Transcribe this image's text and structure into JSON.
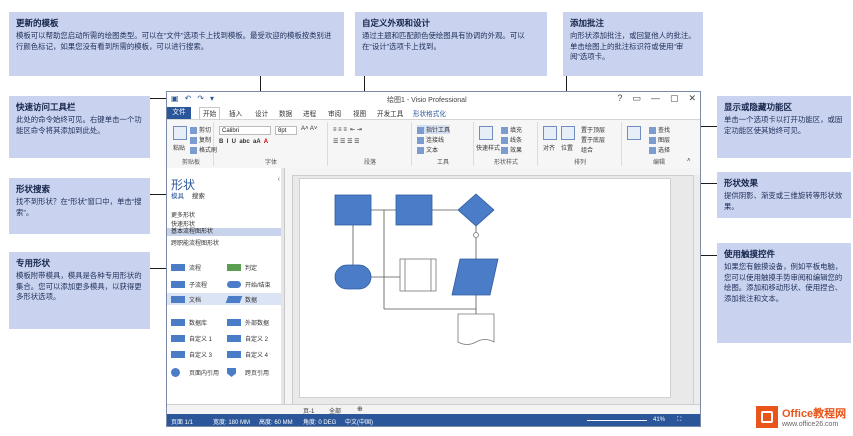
{
  "callouts": {
    "templates": {
      "title": "更新的模板",
      "body": "模板可以帮助您启动所需的绘图类型。可以在“文件”选项卡上找到模板。最受欢迎的模板按类别进行颜色标记，如果您没有看到所需的模板，可以进行搜索。"
    },
    "appearance": {
      "title": "自定义外观和设计",
      "body": "通过主题和匹配颜色使绘图具有协调的外观。可以在“设计”选项卡上找到。"
    },
    "comments": {
      "title": "添加批注",
      "body": "向形状添加批注，或回复他人的批注。单击绘图上的批注标识符或使用“审阅”选项卡。"
    },
    "qat": {
      "title": "快速访问工具栏",
      "body": "此处的命令始终可见。右键单击一个功能区命令将其添加到此处。"
    },
    "ribbon": {
      "title": "显示或隐藏功能区",
      "body": "单击一个选项卡以打开功能区，或固定功能区使其始终可见。"
    },
    "search": {
      "title": "形状搜索",
      "body": "找不到形状？在“形状”窗口中，单击“搜索”。"
    },
    "effects": {
      "title": "形状效果",
      "body": "提供阴影、渐变或三维旋转等形状效果。"
    },
    "stencils": {
      "title": "专用形状",
      "body": "模板附带模具，模具是各种专用形状的集合。您可以添加更多模具，以获得更多形状选项。"
    },
    "touch": {
      "title": "使用触摸控件",
      "body": "如果您有触摸设备，例如平板电脑，您可以使用触摸手势审阅和编辑您的绘图。添加和移动形状、使用捏合、添加批注和文本。"
    }
  },
  "window": {
    "title": "绘图1 - Visio Professional",
    "controls": [
      "?",
      "▭",
      "—",
      "▢",
      "✕"
    ],
    "qat_icons": [
      "save-icon",
      "undo-icon",
      "redo-icon",
      "customize-icon"
    ]
  },
  "tabs": [
    "文件",
    "开始",
    "插入",
    "设计",
    "数据",
    "进程",
    "审阅",
    "视图",
    "开发工具",
    "形状格式化"
  ],
  "ribbon": {
    "groups": [
      "剪贴板",
      "字体",
      "段落",
      "工具",
      "形状样式",
      "排列",
      "编辑"
    ],
    "font_name": "Calibri",
    "font_size": "8pt",
    "clipboard_items": [
      "粘贴",
      "剪切",
      "复制",
      "格式刷"
    ],
    "tools_items": [
      "指针工具",
      "连接线",
      "文本"
    ],
    "style_items": [
      "快速样式",
      "填充",
      "线条",
      "效果"
    ],
    "arrange_items": [
      "对齐",
      "位置",
      "置于顶层",
      "置于底层",
      "组合"
    ],
    "edit_items": [
      "查找",
      "图层",
      "选择"
    ]
  },
  "shapes_pane": {
    "title": "形状",
    "search_label": "模具",
    "search_text": "搜索",
    "links": [
      "更多形状",
      "快速形状"
    ],
    "selected": "基本流程图形状",
    "second": "跨职能流程图形状",
    "stencils": [
      [
        "流程",
        "判定"
      ],
      [
        "子流程",
        "开始/结束"
      ],
      [
        "文档",
        "数据"
      ],
      [
        "数据库",
        "外部数据"
      ],
      [
        "自定义 1",
        "自定义 2"
      ],
      [
        "自定义 3",
        "自定义 4"
      ],
      [
        "页面内引用",
        "跨页引用"
      ]
    ]
  },
  "page_tabs": {
    "page": "页-1",
    "all": "全部"
  },
  "status": {
    "page": "页面 1/1",
    "width": "宽度: 180 MM",
    "height": "高度: 60 MM",
    "angle": "角度: 0 DEG",
    "lang": "中文(中国)",
    "zoom": "41%"
  },
  "logo": {
    "name": "Office教程网",
    "url": "www.office26.com"
  }
}
